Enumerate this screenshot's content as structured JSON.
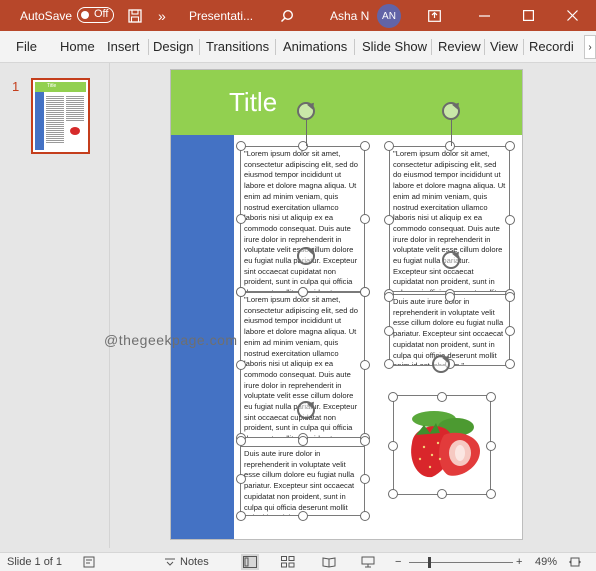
{
  "titlebar": {
    "autosave_label": "AutoSave",
    "autosave_state": "Off",
    "doc_title": "Presentati...",
    "more": "»",
    "user_name": "Asha N",
    "avatar_initials": "AN",
    "accent_color": "#b7472a"
  },
  "menu": {
    "items": [
      "File",
      "Home",
      "Insert",
      "Design",
      "Transitions",
      "Animations",
      "Slide Show",
      "Review",
      "View",
      "Recordi"
    ]
  },
  "thumbnails": {
    "slide_number": "1",
    "thumb_title": "Title"
  },
  "slide": {
    "title": "Title",
    "header_color": "#92d050",
    "sidebar_color": "#4472c4",
    "textboxes": [
      "\"Lorem ipsum dolor sit amet, consectetur adipiscing elit, sed do eiusmod tempor incididunt ut labore et dolore magna aliqua. Ut enim ad minim veniam, quis nostrud exercitation ullamco laboris nisi ut aliquip ex ea commodo consequat. Duis aute irure dolor in reprehenderit in voluptate velit esse cillum dolore eu fugiat nulla pariatur. Excepteur sint occaecat cupidatat non proident, sunt in culpa qui officia deserunt mollit anim id est laborum.\"",
      "\"Lorem ipsum dolor sit amet, consectetur adipiscing elit, sed do eiusmod tempor incididunt ut labore et dolore magna aliqua. Ut enim ad minim veniam, quis nostrud exercitation ullamco laboris nisi ut aliquip ex ea commodo consequat. Duis aute irure dolor in reprehenderit in voluptate velit esse cillum dolore eu fugiat nulla pariatur. Excepteur sint occaecat cupidatat non proident, sunt in culpa qui officia deserunt mollit anim id est laborum.\"",
      "Duis aute irure dolor in reprehenderit in voluptate velit esse cillum dolore eu fugiat nulla pariatur. Excepteur sint occaecat cupidatat non proident, sunt in culpa qui officia deserunt mollit anim id est laborum.\"",
      "\"Lorem ipsum dolor sit amet, consectetur adipiscing elit, sed do eiusmod tempor incididunt ut labore et dolore magna aliqua. Ut enim ad minim veniam, quis nostrud exercitation ullamco laboris nisi ut aliquip ex ea commodo consequat. Duis aute irure dolor in reprehenderit in voluptate velit esse cillum dolore eu fugiat nulla pariatur. Excepteur sint occaecat cupidatat non proident, sunt in culpa qui officia deserunt mollit anim id est laborum.\"",
      "Duis aute irure dolor in reprehenderit in voluptate velit esse cillum dolore eu fugiat nulla pariatur. Excepteur sint occaecat cupidatat non proident, sunt in culpa qui officia deserunt mollit anim id est laborum.\""
    ],
    "image_icon": "strawberry-image"
  },
  "watermark": "@thegeekpage.com",
  "status": {
    "slide_info": "Slide 1 of 1",
    "notes_label": "Notes",
    "zoom_level": "49%"
  }
}
